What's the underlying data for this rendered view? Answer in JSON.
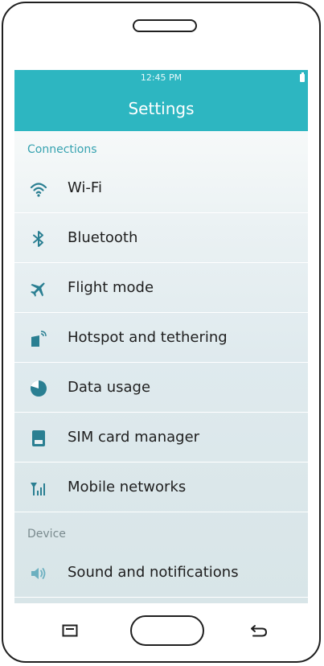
{
  "status_bar": {
    "time": "12:45 PM",
    "battery_icon": "battery-icon"
  },
  "header": {
    "title": "Settings",
    "background": "#2db6c1"
  },
  "sections": [
    {
      "title": "Connections",
      "items": [
        {
          "label": "Wi-Fi",
          "icon": "wifi-icon"
        },
        {
          "label": "Bluetooth",
          "icon": "bluetooth-icon"
        },
        {
          "label": "Flight mode",
          "icon": "airplane-icon"
        },
        {
          "label": "Hotspot and tethering",
          "icon": "hotspot-icon"
        },
        {
          "label": "Data usage",
          "icon": "data-usage-icon"
        },
        {
          "label": "SIM card manager",
          "icon": "sim-card-icon"
        },
        {
          "label": "Mobile networks",
          "icon": "signal-icon"
        }
      ]
    },
    {
      "title": "Device",
      "items": [
        {
          "label": "Sound and notifications",
          "icon": "speaker-icon"
        }
      ]
    }
  ],
  "nav_bar": {
    "recent_icon": "recent-apps-icon",
    "home_icon": "home-button",
    "back_icon": "back-arrow-icon"
  },
  "colors": {
    "accent": "#2db6c1",
    "icon": "#2a7f92",
    "section_header": "#36a2b0"
  }
}
